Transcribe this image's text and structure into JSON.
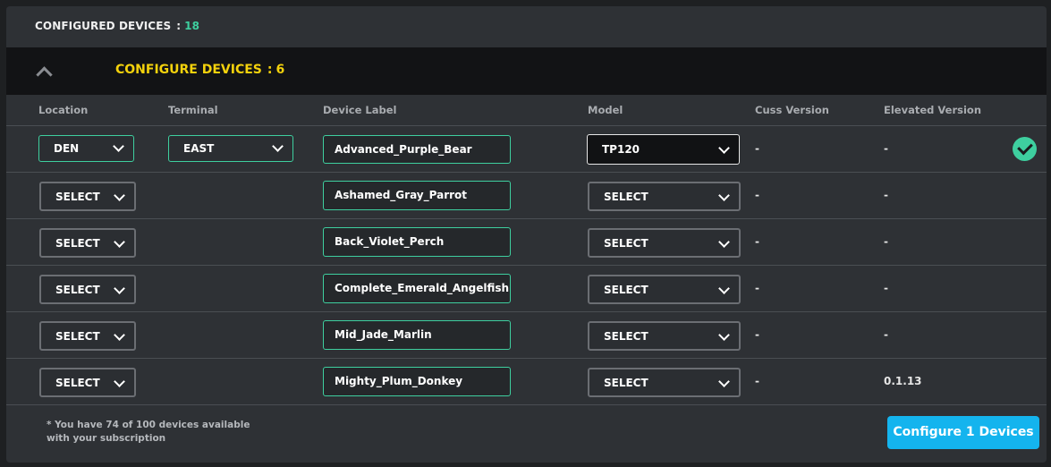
{
  "header": {
    "configured_label": "CONFIGURED DEVICES",
    "configured_sep": ":",
    "configured_count": "18"
  },
  "section": {
    "title": "CONFIGURE DEVICES",
    "sep": ":",
    "count": "6",
    "collapse_icon": "chevron-up-icon"
  },
  "columns": {
    "location": "Location",
    "terminal": "Terminal",
    "device_label": "Device Label",
    "model": "Model",
    "cuss_version": "Cuss Version",
    "elevated_version": "Elevated Version"
  },
  "rows": [
    {
      "location": "DEN",
      "terminal": "EAST",
      "label": "Advanced_Purple_Bear",
      "model": "TP120",
      "cuss": "-",
      "elevated": "-",
      "status_icon": "check-circle-icon"
    },
    {
      "location": "SELECT",
      "terminal": "",
      "label": "Ashamed_Gray_Parrot",
      "model": "SELECT",
      "cuss": "-",
      "elevated": "-"
    },
    {
      "location": "SELECT",
      "terminal": "",
      "label": "Back_Violet_Perch",
      "model": "SELECT",
      "cuss": "-",
      "elevated": "-"
    },
    {
      "location": "SELECT",
      "terminal": "",
      "label": "Complete_Emerald_Angelfish",
      "model": "SELECT",
      "cuss": "-",
      "elevated": "-"
    },
    {
      "location": "SELECT",
      "terminal": "",
      "label": "Mid_Jade_Marlin",
      "model": "SELECT",
      "cuss": "-",
      "elevated": "-"
    },
    {
      "location": "SELECT",
      "terminal": "",
      "label": "Mighty_Plum_Donkey",
      "model": "SELECT",
      "cuss": "-",
      "elevated": "0.1.13"
    }
  ],
  "footer": {
    "note_line1": "* You have 74 of 100 devices available",
    "note_line2": "with your subscription",
    "button": "Configure 1 Devices"
  },
  "colors": {
    "accent_green": "#3ecf9f",
    "title_yellow": "#f4d20c",
    "button_blue": "#14b4ee"
  }
}
